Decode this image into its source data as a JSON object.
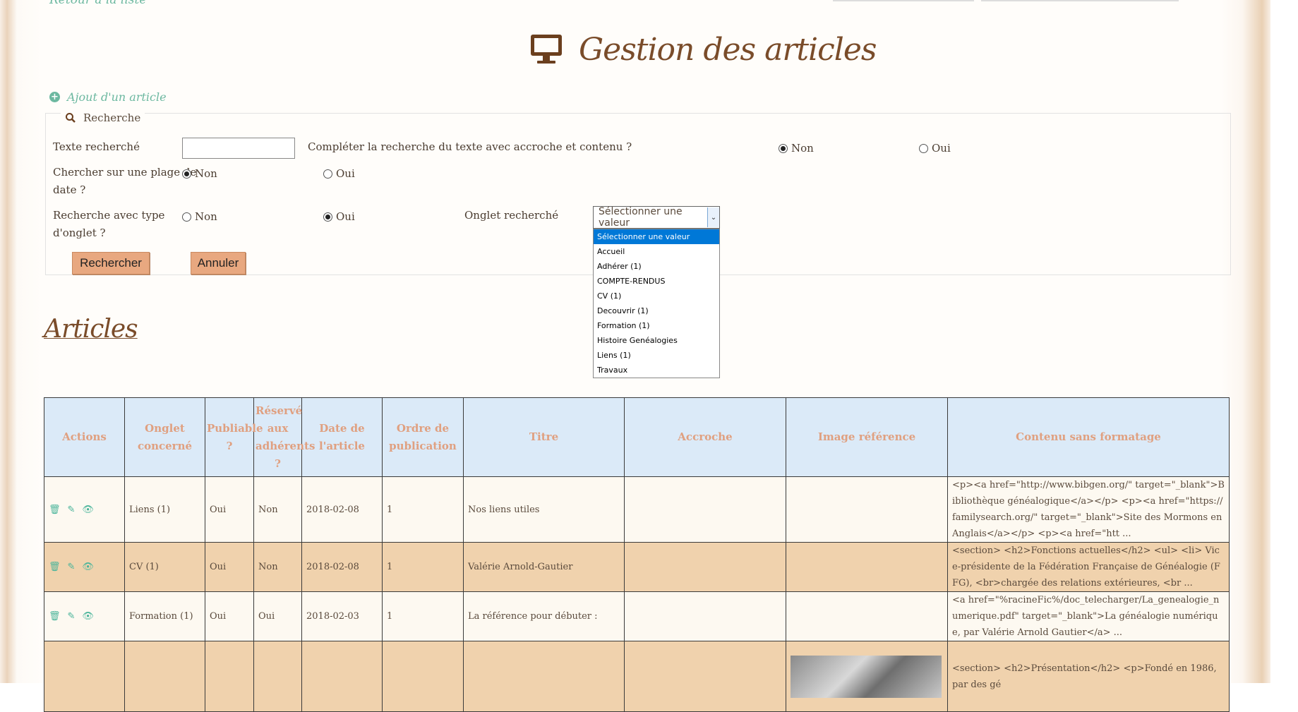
{
  "nav": {
    "back_label": "Retour à la liste"
  },
  "page": {
    "title": "Gestion des articles"
  },
  "actions": {
    "add_label": "Ajout d'un article"
  },
  "search": {
    "legend": "Recherche",
    "text_label": "Texte recherché",
    "text_value": "",
    "complete_label": "Compléter la recherche du texte avec accroche et contenu ?",
    "complete_non": "Non",
    "complete_oui": "Oui",
    "date_label_1": "Chercher sur une plage de",
    "date_label_2": "date ?",
    "date_non": "Non",
    "date_oui": "Oui",
    "type_label_1": "Recherche avec type",
    "type_label_2": "d'onglet ?",
    "type_non": "Non",
    "type_oui": "Oui",
    "tab_label": "Onglet recherché",
    "select_value": "Sélectionner une valeur",
    "options": [
      "Sélectionner une valeur",
      "Accueil",
      "Adhérer (1)",
      "COMPTE-RENDUS",
      "CV (1)",
      "Decouvrir (1)",
      "Formation (1)",
      "Histoire Genéalogies",
      "Liens (1)",
      "Travaux"
    ],
    "search_button": "Rechercher",
    "cancel_button": "Annuler"
  },
  "articles": {
    "heading": "Articles",
    "columns": [
      "Actions",
      "Onglet concerné",
      "Publiable ?",
      "Réservé aux adhérents ?",
      "Date de l'article",
      "Ordre de publication",
      "Titre",
      "Accroche",
      "Image référence",
      "Contenu sans formatage"
    ],
    "rows": [
      {
        "onglet": "Liens (1)",
        "publiable": "Oui",
        "reserve": "Non",
        "date": "2018-02-08",
        "ordre": "1",
        "titre": "Nos liens utiles",
        "accroche": "",
        "contenu": "<p><a href=\"http://www.bibgen.org/\" target=\"_blank\">Bibliothèque généalogique</a></p> <p><a href=\"https://familysearch.org/\" target=\"_blank\">Site des Mormons en Anglais</a></p> <p><a href=\"htt ..."
      },
      {
        "onglet": "CV (1)",
        "publiable": "Oui",
        "reserve": "Non",
        "date": "2018-02-08",
        "ordre": "1",
        "titre": "Valérie Arnold-Gautier",
        "accroche": "",
        "contenu": "<section> <h2>Fonctions actuelles</h2> <ul> <li> Vice-présidente de la Fédération Française de Généalogie (FFG), <br>chargée des relations extérieures, <br ..."
      },
      {
        "onglet": "Formation (1)",
        "publiable": "Oui",
        "reserve": "Oui",
        "date": "2018-02-03",
        "ordre": "1",
        "titre": "La référence pour débuter :",
        "accroche": "",
        "contenu": "<a href=\"%racineFic%/doc_telecharger/La_genealogie_numerique.pdf\" target=\"_blank\">La généalogie numérique, par Valérie Arnold Gautier</a> ..."
      },
      {
        "onglet": "",
        "publiable": "",
        "reserve": "",
        "date": "",
        "ordre": "",
        "titre": "",
        "accroche": "",
        "contenu": "<section> <h2>Présentation</h2> <p>Fondé en 1986, par des gé"
      }
    ]
  },
  "colors": {
    "accent": "#6cb8a0",
    "brown": "#7a4c2a",
    "button": "#e8a880",
    "header_bg": "#dbeaf8",
    "row_alt": "#f0d2ad"
  }
}
